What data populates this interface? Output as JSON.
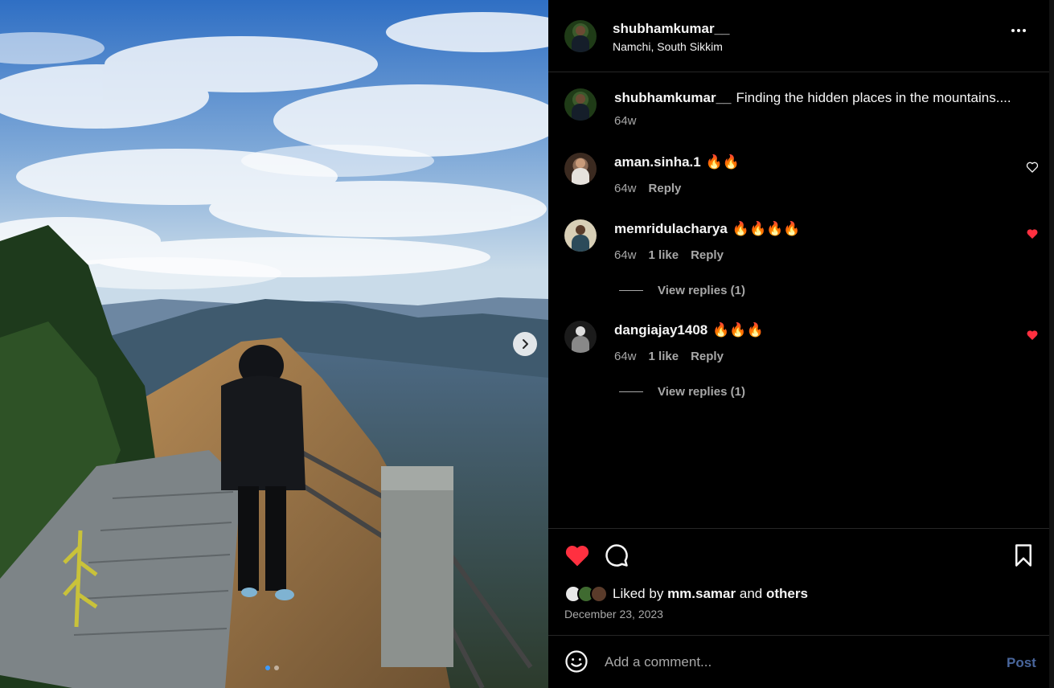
{
  "post": {
    "author": "shubhamkumar__",
    "location": "Namchi, South Sikkim",
    "caption": "Finding the hidden places in the mountains....",
    "caption_age": "64w",
    "photo_index": 1,
    "photo_count": 2
  },
  "comments": [
    {
      "user": "aman.sinha.1",
      "text": "🔥🔥",
      "age": "64w",
      "likes": "",
      "reply": "Reply",
      "liked": false
    },
    {
      "user": "memridulacharya",
      "text": "🔥🔥🔥🔥",
      "age": "64w",
      "likes": "1 like",
      "reply": "Reply",
      "liked": true,
      "view_replies": "View replies (1)"
    },
    {
      "user": "dangiajay1408",
      "text": "🔥🔥🔥",
      "age": "64w",
      "likes": "1 like",
      "reply": "Reply",
      "liked": true,
      "view_replies": "View replies (1)"
    }
  ],
  "actions": {
    "liked": true,
    "liked_by_prefix": "Liked by",
    "liked_by_user": "mm.samar",
    "liked_by_and": "and",
    "liked_by_others": "others",
    "date": "December 23, 2023"
  },
  "add_comment": {
    "placeholder": "Add a comment...",
    "post_label": "Post"
  },
  "colors": {
    "like_red": "#ff3040",
    "post_disabled": "#49669c",
    "active_dot": "#3d9bff"
  },
  "icons": [
    "next-arrow-icon",
    "more-options-icon",
    "heart-icon",
    "comment-icon",
    "bookmark-icon",
    "emoji-icon"
  ]
}
